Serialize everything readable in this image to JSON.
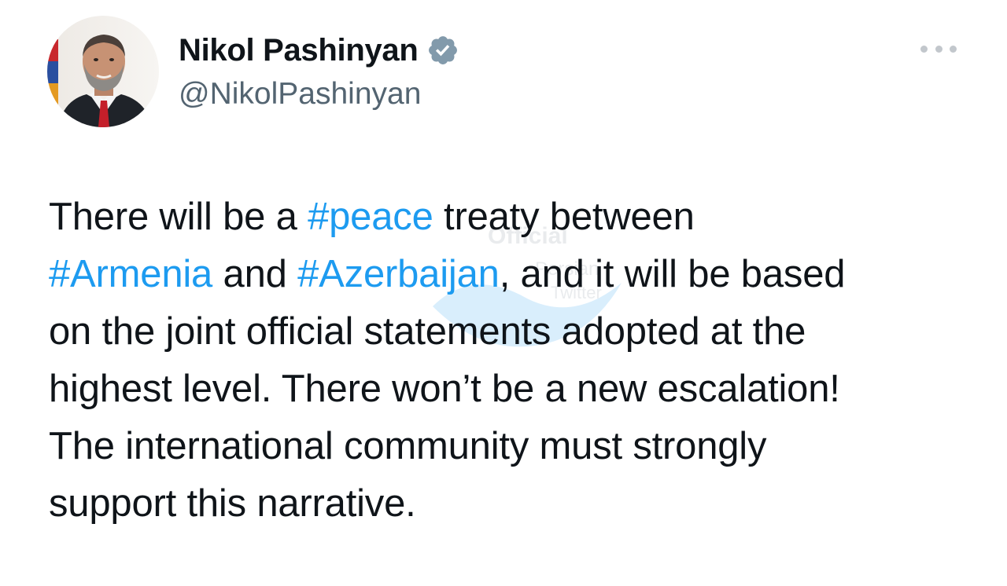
{
  "author": {
    "display_name": "Nikol Pashinyan",
    "handle": "@NikolPashinyan",
    "verified": true,
    "avatar_icon": "profile-photo"
  },
  "menu": {
    "more_icon": "more-horizontal-icon"
  },
  "tweet": {
    "lines": [
      [
        {
          "text": "There will be a ",
          "hashtag": false
        },
        {
          "text": "#peace",
          "hashtag": true
        },
        {
          "text": " treaty between",
          "hashtag": false
        }
      ],
      [
        {
          "text": "#Armenia",
          "hashtag": true
        },
        {
          "text": " and ",
          "hashtag": false
        },
        {
          "text": "#Azerbaijan",
          "hashtag": true
        },
        {
          "text": ", and it will be based",
          "hashtag": false
        }
      ],
      [
        {
          "text": "on the joint official statements adopted at the",
          "hashtag": false
        }
      ],
      [
        {
          "text": "highest level. There won’t be a new escalation!",
          "hashtag": false
        }
      ],
      [
        {
          "text": "The international community must strongly",
          "hashtag": false
        }
      ],
      [
        {
          "text": "support this narrative.",
          "hashtag": false
        }
      ]
    ]
  },
  "watermark": {
    "line1": "Official",
    "line2": "Persian",
    "line3": "Twitter"
  },
  "colors": {
    "hashtag": "#1d9bf0",
    "handle": "#536471",
    "verified_badge": "#829aab",
    "text": "#0f1419"
  }
}
